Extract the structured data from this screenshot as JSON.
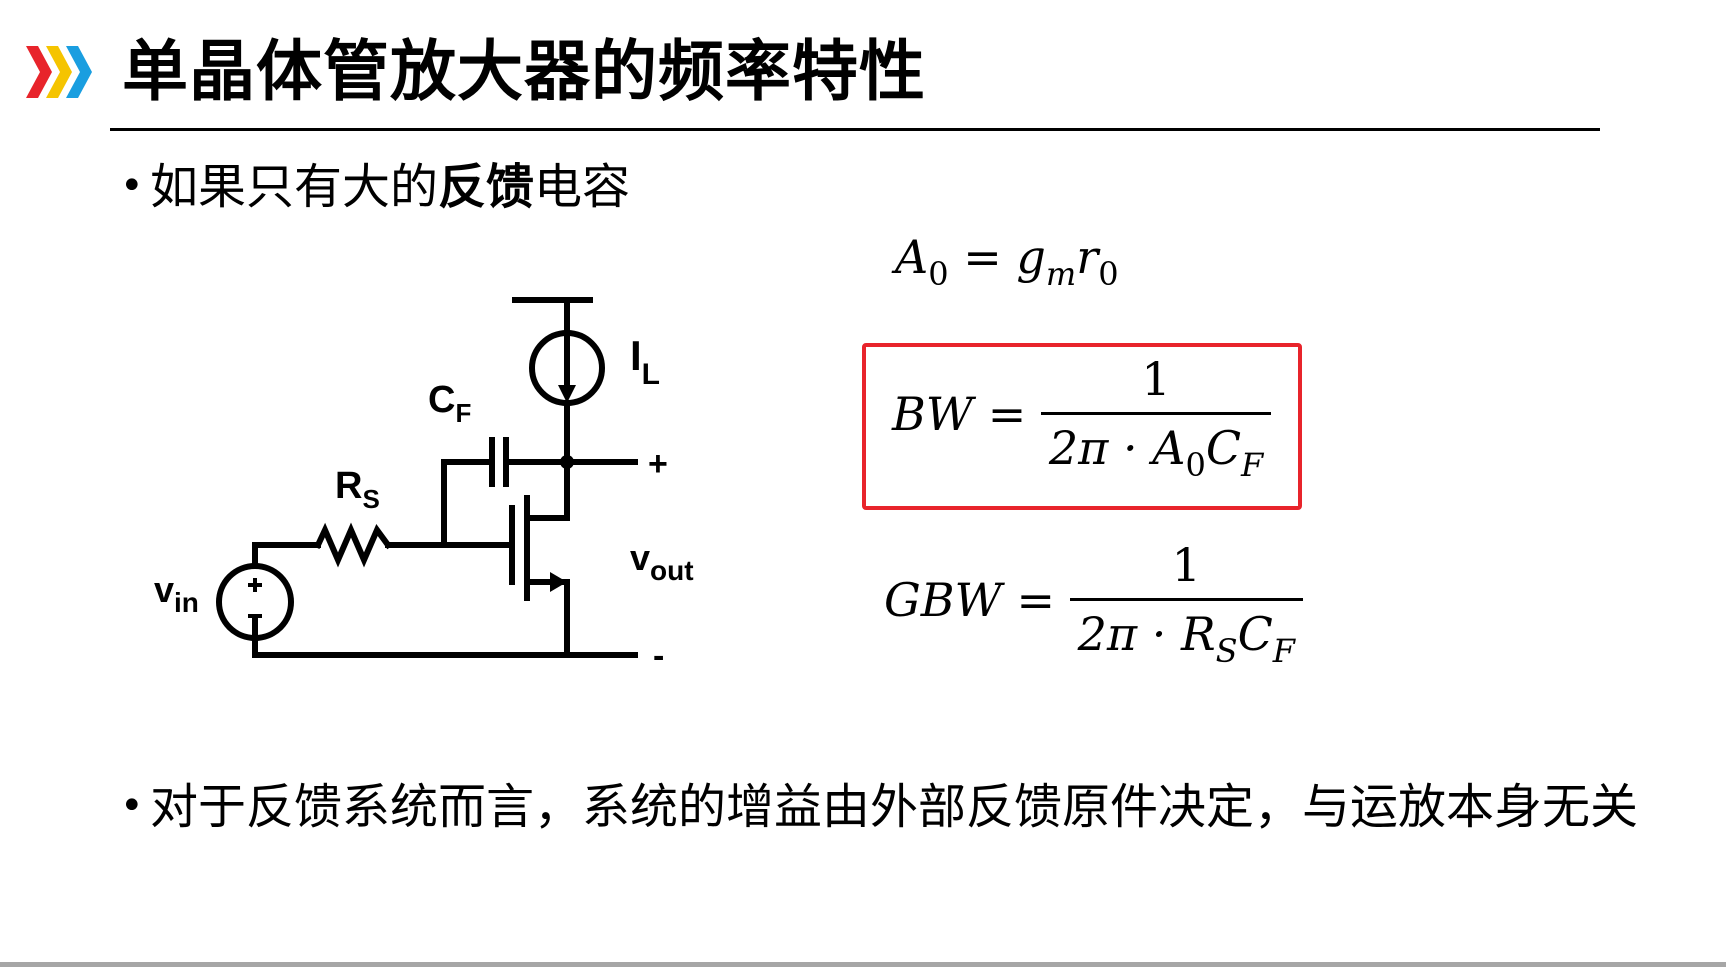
{
  "slide": {
    "title": "单晶体管放大器的频率特性",
    "bullet1": {
      "prefix": "如果只有大的",
      "bold": "反馈",
      "suffix": "电容"
    },
    "bullet2": "对于反馈系统而言，系统的增益由外部反馈原件决定，与运放本身无关"
  },
  "circuit": {
    "labels": {
      "il": "I",
      "il_sub": "L",
      "cf": "C",
      "cf_sub": "F",
      "rs": "R",
      "rs_sub": "S",
      "vin": "v",
      "vin_sub": "in",
      "vout": "v",
      "vout_sub": "out",
      "plus": "+",
      "minus": "-"
    }
  },
  "equations": {
    "a0": {
      "lhs": "A",
      "lhs_sub": "0",
      "eq": "=",
      "g": "g",
      "g_sub": "m",
      "r": "r",
      "r_sub": "0"
    },
    "bw": {
      "lhs": "BW",
      "eq": "=",
      "num": "1",
      "den_pre": "2π · A",
      "den_sub1": "0",
      "den_mid": "C",
      "den_sub2": "F"
    },
    "gbw": {
      "lhs": "GBW",
      "eq": "=",
      "num": "1",
      "den_pre": "2π · R",
      "den_sub1": "S",
      "den_mid": "C",
      "den_sub2": "F"
    }
  },
  "colors": {
    "chevron1": "#e8242b",
    "chevron2": "#f5c400",
    "chevron3": "#1a9ee0",
    "highlight_box": "#e8242b"
  }
}
